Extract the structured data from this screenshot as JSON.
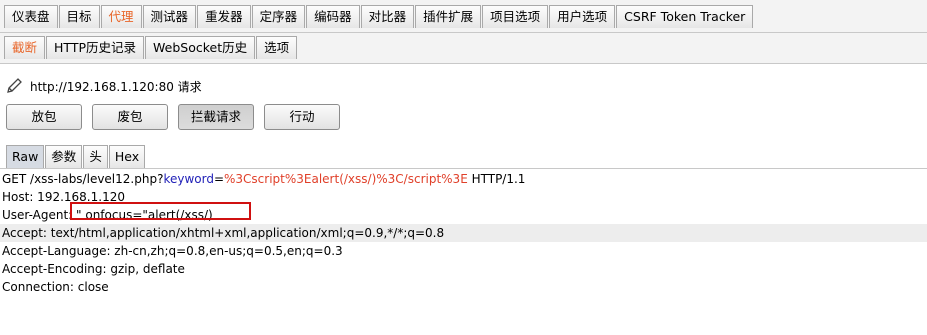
{
  "top_tabs": [
    "仪表盘",
    "目标",
    "代理",
    "测试器",
    "重发器",
    "定序器",
    "编码器",
    "对比器",
    "插件扩展",
    "项目选项",
    "用户选项",
    "CSRF Token Tracker"
  ],
  "active_top_tab": "代理",
  "sub_tabs": [
    "截断",
    "HTTP历史记录",
    "WebSocket历史",
    "选项"
  ],
  "active_sub_tab": "截断",
  "request_target": "http://192.168.1.120:80 请求",
  "buttons": {
    "forward": "放包",
    "drop": "废包",
    "intercept": "拦截请求",
    "action": "行动"
  },
  "view_tabs": [
    "Raw",
    "参数",
    "头",
    "Hex"
  ],
  "active_view_tab": "Raw",
  "request": {
    "line1": {
      "method_path": "GET /xss-labs/level12.php?",
      "param_name": "keyword",
      "equals": "=",
      "param_value": "%3Cscript%3Ealert(/xss/)%3C/script%3E",
      "protocol": " HTTP/1.1"
    },
    "host": "Host: 192.168.1.120",
    "user_agent": "User-Agent: \" onfocus=\"alert(/xss/)",
    "accept": "Accept: text/html,application/xhtml+xml,application/xml;q=0.9,*/*;q=0.8",
    "accept_language": "Accept-Language: zh-cn,zh;q=0.8,en-us;q=0.5,en;q=0.3",
    "accept_encoding": "Accept-Encoding: gzip, deflate",
    "connection": "Connection: close"
  },
  "colors": {
    "accent": "#e8662a",
    "param_name": "#2222b8",
    "param_value": "#e0402a",
    "highlight_box": "#d01010"
  },
  "icons": {
    "edit": "pencil-icon"
  }
}
